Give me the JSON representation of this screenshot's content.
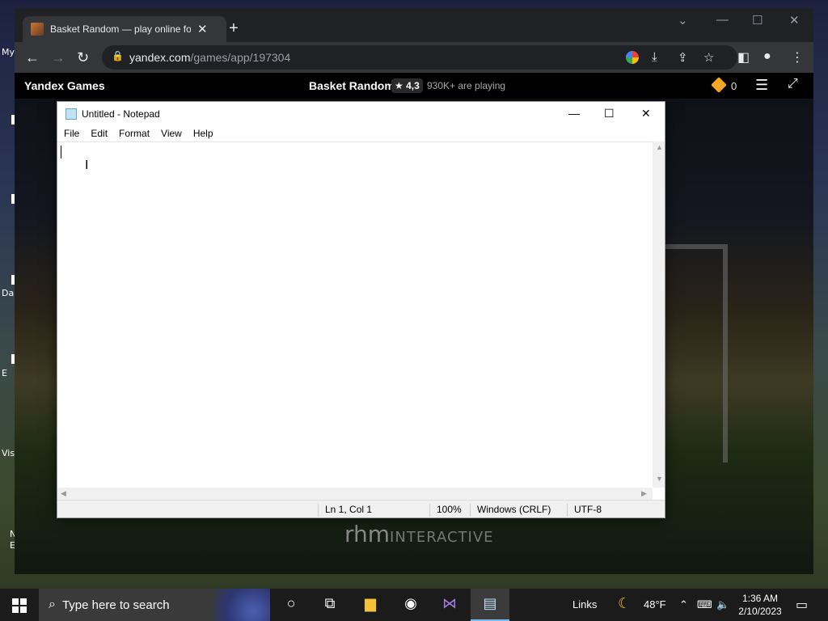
{
  "desktop": {
    "labels": [
      "My",
      "Da",
      "E",
      "Vis",
      "N",
      "E"
    ]
  },
  "browser": {
    "tab_title": "Basket Random — play online for",
    "url_host": "yandex.com",
    "url_path": "/games/app/197304"
  },
  "yandex_bar": {
    "brand": "Yandex Games",
    "game_title": "Basket Random",
    "rating": "★ 4,3",
    "players": "930K+ are playing",
    "coins": "0"
  },
  "game": {
    "logo_main": "rhm",
    "logo_sub": "INTERACTIVE"
  },
  "notepad": {
    "title": "Untitled - Notepad",
    "menu": [
      "File",
      "Edit",
      "Format",
      "View",
      "Help"
    ],
    "status": {
      "position": "Ln 1, Col 1",
      "zoom": "100%",
      "line_ending": "Windows (CRLF)",
      "encoding": "UTF-8"
    }
  },
  "taskbar": {
    "search_placeholder": "Type here to search",
    "links_label": "Links",
    "weather": "48°F",
    "time": "1:36 AM",
    "date": "2/10/2023"
  }
}
